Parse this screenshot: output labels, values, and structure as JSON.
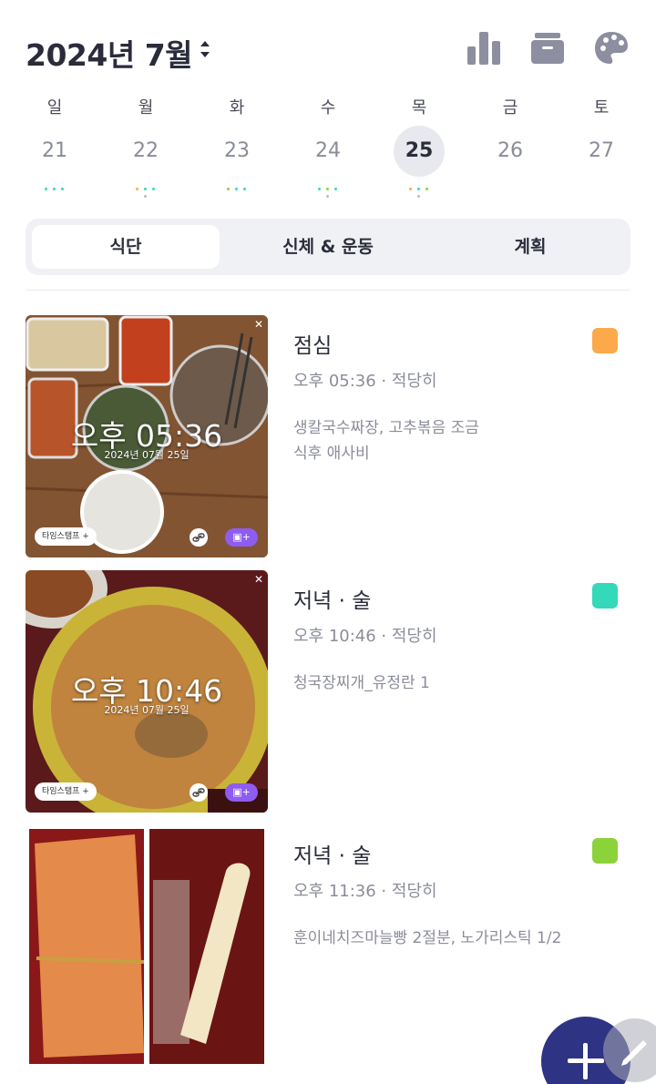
{
  "header": {
    "month_title": "2024년 7월",
    "icons": [
      "bar-chart-icon",
      "archive-box-icon",
      "palette-icon"
    ]
  },
  "week": {
    "weekdays": [
      "일",
      "월",
      "화",
      "수",
      "목",
      "금",
      "토"
    ],
    "dates": [
      "21",
      "22",
      "23",
      "24",
      "25",
      "26",
      "27"
    ],
    "selected": "25"
  },
  "tabs": [
    "식단",
    "신체 & 운동",
    "계획"
  ],
  "active_tab": "식단",
  "timestamp_overlay": {
    "chip_label": "타임스탬프 +"
  },
  "meals": [
    {
      "title": "점심",
      "meta": "오후 05:36  ·  적당히",
      "desc_line1": "생칼국수짜장, 고추볶음 조금",
      "desc_line2": "식후 애사비",
      "tag_color": "#fba94a",
      "photo_time": "오후 05:36",
      "photo_date": "2024년 07월 25일"
    },
    {
      "title": "저녁 · 술",
      "meta": "오후 10:46  ·  적당히",
      "desc_line1": "청국장찌개_유정란 1",
      "desc_line2": "",
      "tag_color": "#33d9b9",
      "photo_time": "오후 10:46",
      "photo_date": "2024년 07월 25일"
    },
    {
      "title": "저녁 · 술",
      "meta": "오후 11:36  ·  적당히",
      "desc_line1": "훈이네치즈마늘빵 2절분, 노가리스틱 1/2",
      "desc_line2": "",
      "tag_color": "#8cd23a"
    }
  ],
  "colors": {
    "accent": "#2e3384",
    "selected_day_bg": "#e8e9ee"
  }
}
